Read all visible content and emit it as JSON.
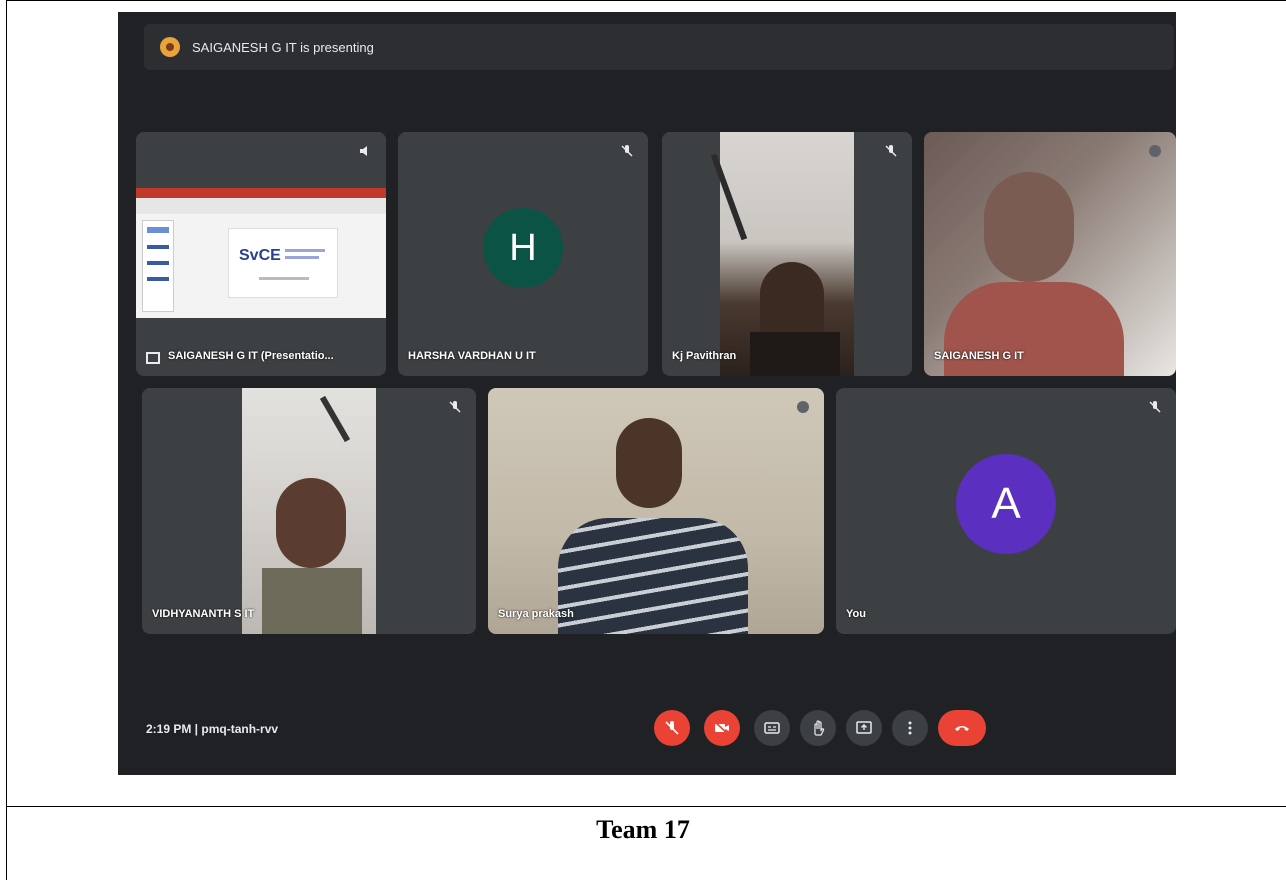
{
  "presenting_banner": "SAIGANESH G IT is presenting",
  "tiles": [
    {
      "name": "SAIGANESH G IT (Presentatio..."
    },
    {
      "name": "HARSHA VARDHAN U IT",
      "initial": "H"
    },
    {
      "name": "Kj Pavithran"
    },
    {
      "name": "SAIGANESH G IT"
    },
    {
      "name": "VIDHYANANTH S IT"
    },
    {
      "name": "Surya prakash"
    },
    {
      "name": "You",
      "initial": "A"
    }
  ],
  "slide_logo": "SvCE",
  "meeting_info": "2:19 PM  |  pmq-tanh-rvv",
  "controls": [
    "mic-off-icon",
    "camera-off-icon",
    "captions-icon",
    "raise-hand-icon",
    "present-icon",
    "more-icon",
    "end-call-icon"
  ],
  "caption": "Team 17",
  "colors": {
    "background": "#202124",
    "tile": "#3c4043",
    "danger": "#ea4335",
    "avatar_h": "#0b5345",
    "avatar_a": "#5b2fbf"
  }
}
